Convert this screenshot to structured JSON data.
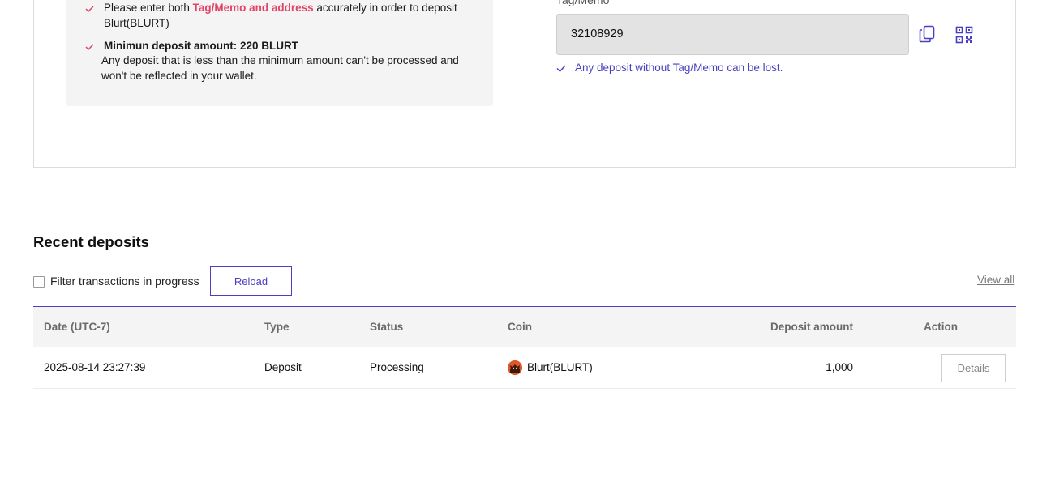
{
  "notice": {
    "item1_prefix": "Please enter both ",
    "item1_highlight": "Tag/Memo and address",
    "item1_suffix": " accurately in order to deposit Blurt(BLURT)",
    "item2_title": "Minimun deposit amount: 220 BLURT",
    "item2_body": "Any deposit that is less than the minimum amount can't be processed and won't be reflected in your wallet."
  },
  "memo": {
    "label": "Tag/Memo",
    "value": "32108929",
    "hint": "Any deposit without Tag/Memo can be lost.",
    "copy_icon": "copy-icon",
    "qr_icon": "qr-code-icon"
  },
  "recent": {
    "title": "Recent deposits",
    "filter_label": "Filter transactions in progress",
    "reload_label": "Reload",
    "view_all_label": "View all"
  },
  "table": {
    "headers": {
      "date": "Date (UTC-7)",
      "type": "Type",
      "status": "Status",
      "coin": "Coin",
      "amount": "Deposit amount",
      "action": "Action"
    },
    "rows": [
      {
        "date": "2025-08-14 23:27:39",
        "type": "Deposit",
        "status": "Processing",
        "coin": "Blurt(BLURT)",
        "coin_icon": "blurt-coin-icon",
        "amount": "1,000",
        "action": "Details"
      }
    ]
  },
  "colors": {
    "accent": "#4a3fc0",
    "highlight": "#e24466",
    "check": "#e24466"
  }
}
